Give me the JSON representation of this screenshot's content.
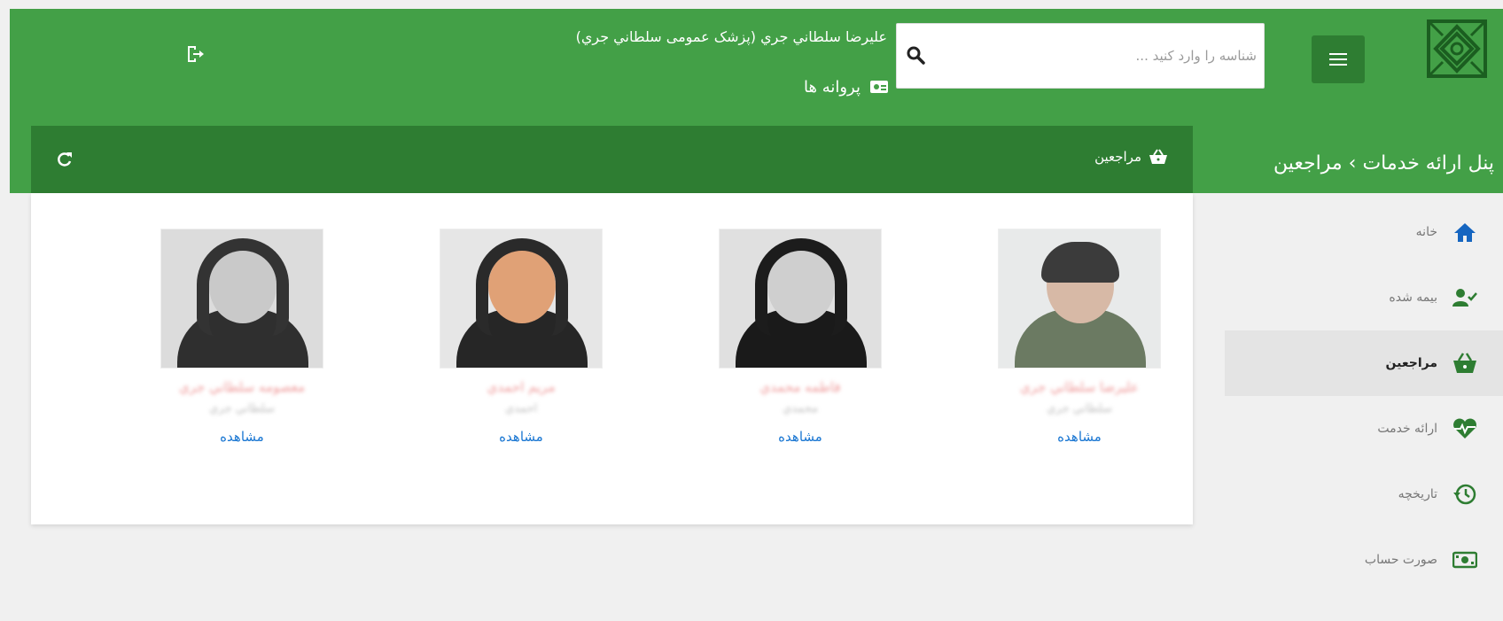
{
  "header": {
    "search_placeholder": "شناسه را وارد کنید ...",
    "user_text": "علیرضا سلطاني جري (پزشک عمومی سلطاني جري)",
    "licenses_label": "پروانه ها"
  },
  "breadcrumb": {
    "text": "پنل ارائه خدمات › مراجعین"
  },
  "panel": {
    "title": "مراجعین"
  },
  "patients": [
    {
      "name": "علیرضا سلطاني جري",
      "sub": "سلطاني جري",
      "view_label": "مشاهده"
    },
    {
      "name": "فاطمه محمدي",
      "sub": "محمدي",
      "view_label": "مشاهده"
    },
    {
      "name": "مریم احمدي",
      "sub": "احمدي",
      "view_label": "مشاهده"
    },
    {
      "name": "معصومه سلطاني جري",
      "sub": "سلطاني جري",
      "view_label": "مشاهده"
    }
  ],
  "sidebar": {
    "items": [
      {
        "label": "خانه",
        "icon": "home-icon"
      },
      {
        "label": "بیمه شده",
        "icon": "user-check-icon"
      },
      {
        "label": "مراجعین",
        "icon": "basket-icon",
        "active": true
      },
      {
        "label": "ارائه خدمت",
        "icon": "heart-pulse-icon"
      },
      {
        "label": "تاریخچه",
        "icon": "history-icon"
      },
      {
        "label": "صورت حساب",
        "icon": "bill-icon"
      }
    ]
  },
  "colors": {
    "header_green": "#43a047",
    "dark_green": "#2e7d32",
    "link_blue": "#1976d2",
    "home_blue": "#1565c0"
  }
}
